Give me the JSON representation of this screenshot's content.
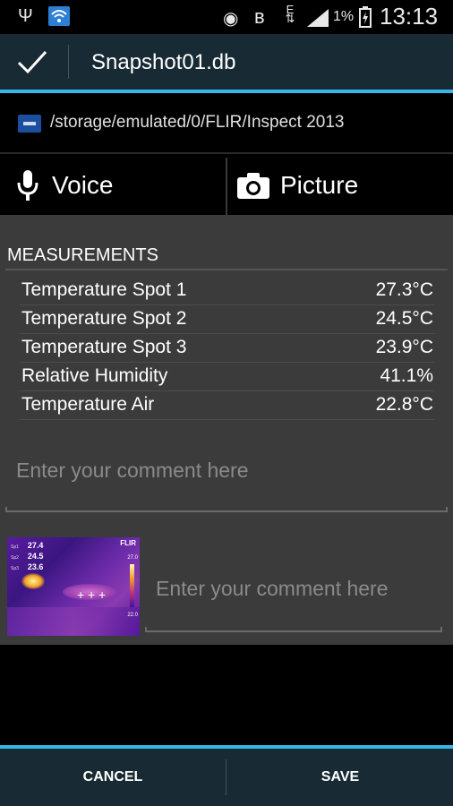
{
  "status_bar": {
    "battery_percent": "1%",
    "time": "13:13"
  },
  "action_bar": {
    "title": "Snapshot01.db"
  },
  "path": {
    "text": "/storage/emulated/0/FLIR/Inspect 2013"
  },
  "media": {
    "voice_label": "Voice",
    "picture_label": "Picture"
  },
  "measurements": {
    "header": "MEASUREMENTS",
    "items": [
      {
        "name": "Temperature Spot 1",
        "value": "27.3°C"
      },
      {
        "name": "Temperature Spot 2",
        "value": "24.5°C"
      },
      {
        "name": "Temperature Spot 3",
        "value": "23.9°C"
      },
      {
        "name": "Relative Humidity",
        "value": "41.1%"
      },
      {
        "name": "Temperature Air",
        "value": "22.8°C"
      }
    ]
  },
  "comment1": {
    "placeholder": "Enter your comment here"
  },
  "thumbnail": {
    "readings": [
      "27.4",
      "24.5",
      "23.6"
    ],
    "logo": "FLIR",
    "scale_max": "27.0",
    "scale_min": "22.0"
  },
  "comment2": {
    "placeholder": "Enter your comment here"
  },
  "bottom_bar": {
    "cancel_label": "CANCEL",
    "save_label": "SAVE"
  },
  "colors": {
    "accent": "#36b7e8",
    "action_bar_bg": "#182a33",
    "panel_bg": "#3b3b3b"
  },
  "icons": {
    "status": [
      "usb-icon",
      "wifi-icon",
      "eye-icon",
      "bluetooth-icon",
      "edge-data-icon",
      "signal-icon",
      "battery-charging-icon"
    ],
    "action": "checkmark-icon",
    "folder": "flir-folder-icon",
    "voice": "microphone-icon",
    "picture": "camera-icon"
  }
}
